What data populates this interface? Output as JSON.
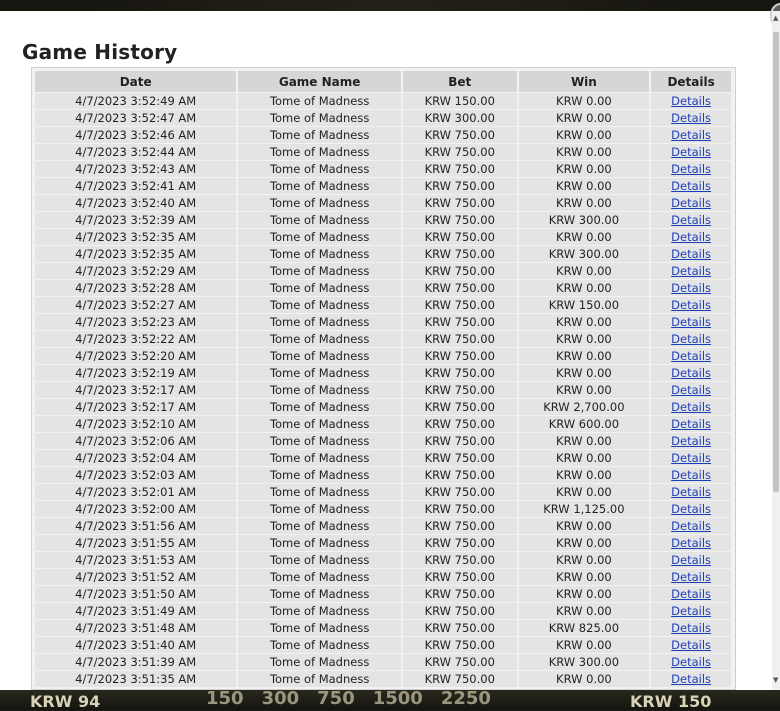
{
  "modal": {
    "title": "Game History",
    "columns": [
      "Date",
      "Game Name",
      "Bet",
      "Win",
      "Details"
    ]
  },
  "rows": [
    {
      "date": "4/7/2023 3:52:49 AM",
      "game": "Tome of Madness",
      "bet": "KRW 150.00",
      "win": "KRW 0.00",
      "details": "Details"
    },
    {
      "date": "4/7/2023 3:52:47 AM",
      "game": "Tome of Madness",
      "bet": "KRW 300.00",
      "win": "KRW 0.00",
      "details": "Details"
    },
    {
      "date": "4/7/2023 3:52:46 AM",
      "game": "Tome of Madness",
      "bet": "KRW 750.00",
      "win": "KRW 0.00",
      "details": "Details"
    },
    {
      "date": "4/7/2023 3:52:44 AM",
      "game": "Tome of Madness",
      "bet": "KRW 750.00",
      "win": "KRW 0.00",
      "details": "Details"
    },
    {
      "date": "4/7/2023 3:52:43 AM",
      "game": "Tome of Madness",
      "bet": "KRW 750.00",
      "win": "KRW 0.00",
      "details": "Details"
    },
    {
      "date": "4/7/2023 3:52:41 AM",
      "game": "Tome of Madness",
      "bet": "KRW 750.00",
      "win": "KRW 0.00",
      "details": "Details"
    },
    {
      "date": "4/7/2023 3:52:40 AM",
      "game": "Tome of Madness",
      "bet": "KRW 750.00",
      "win": "KRW 0.00",
      "details": "Details"
    },
    {
      "date": "4/7/2023 3:52:39 AM",
      "game": "Tome of Madness",
      "bet": "KRW 750.00",
      "win": "KRW 300.00",
      "details": "Details"
    },
    {
      "date": "4/7/2023 3:52:35 AM",
      "game": "Tome of Madness",
      "bet": "KRW 750.00",
      "win": "KRW 0.00",
      "details": "Details"
    },
    {
      "date": "4/7/2023 3:52:35 AM",
      "game": "Tome of Madness",
      "bet": "KRW 750.00",
      "win": "KRW 300.00",
      "details": "Details"
    },
    {
      "date": "4/7/2023 3:52:29 AM",
      "game": "Tome of Madness",
      "bet": "KRW 750.00",
      "win": "KRW 0.00",
      "details": "Details"
    },
    {
      "date": "4/7/2023 3:52:28 AM",
      "game": "Tome of Madness",
      "bet": "KRW 750.00",
      "win": "KRW 0.00",
      "details": "Details"
    },
    {
      "date": "4/7/2023 3:52:27 AM",
      "game": "Tome of Madness",
      "bet": "KRW 750.00",
      "win": "KRW 150.00",
      "details": "Details"
    },
    {
      "date": "4/7/2023 3:52:23 AM",
      "game": "Tome of Madness",
      "bet": "KRW 750.00",
      "win": "KRW 0.00",
      "details": "Details"
    },
    {
      "date": "4/7/2023 3:52:22 AM",
      "game": "Tome of Madness",
      "bet": "KRW 750.00",
      "win": "KRW 0.00",
      "details": "Details"
    },
    {
      "date": "4/7/2023 3:52:20 AM",
      "game": "Tome of Madness",
      "bet": "KRW 750.00",
      "win": "KRW 0.00",
      "details": "Details"
    },
    {
      "date": "4/7/2023 3:52:19 AM",
      "game": "Tome of Madness",
      "bet": "KRW 750.00",
      "win": "KRW 0.00",
      "details": "Details"
    },
    {
      "date": "4/7/2023 3:52:17 AM",
      "game": "Tome of Madness",
      "bet": "KRW 750.00",
      "win": "KRW 0.00",
      "details": "Details"
    },
    {
      "date": "4/7/2023 3:52:17 AM",
      "game": "Tome of Madness",
      "bet": "KRW 750.00",
      "win": "KRW 2,700.00",
      "details": "Details"
    },
    {
      "date": "4/7/2023 3:52:10 AM",
      "game": "Tome of Madness",
      "bet": "KRW 750.00",
      "win": "KRW 600.00",
      "details": "Details"
    },
    {
      "date": "4/7/2023 3:52:06 AM",
      "game": "Tome of Madness",
      "bet": "KRW 750.00",
      "win": "KRW 0.00",
      "details": "Details"
    },
    {
      "date": "4/7/2023 3:52:04 AM",
      "game": "Tome of Madness",
      "bet": "KRW 750.00",
      "win": "KRW 0.00",
      "details": "Details"
    },
    {
      "date": "4/7/2023 3:52:03 AM",
      "game": "Tome of Madness",
      "bet": "KRW 750.00",
      "win": "KRW 0.00",
      "details": "Details"
    },
    {
      "date": "4/7/2023 3:52:01 AM",
      "game": "Tome of Madness",
      "bet": "KRW 750.00",
      "win": "KRW 0.00",
      "details": "Details"
    },
    {
      "date": "4/7/2023 3:52:00 AM",
      "game": "Tome of Madness",
      "bet": "KRW 750.00",
      "win": "KRW 1,125.00",
      "details": "Details"
    },
    {
      "date": "4/7/2023 3:51:56 AM",
      "game": "Tome of Madness",
      "bet": "KRW 750.00",
      "win": "KRW 0.00",
      "details": "Details"
    },
    {
      "date": "4/7/2023 3:51:55 AM",
      "game": "Tome of Madness",
      "bet": "KRW 750.00",
      "win": "KRW 0.00",
      "details": "Details"
    },
    {
      "date": "4/7/2023 3:51:53 AM",
      "game": "Tome of Madness",
      "bet": "KRW 750.00",
      "win": "KRW 0.00",
      "details": "Details"
    },
    {
      "date": "4/7/2023 3:51:52 AM",
      "game": "Tome of Madness",
      "bet": "KRW 750.00",
      "win": "KRW 0.00",
      "details": "Details"
    },
    {
      "date": "4/7/2023 3:51:50 AM",
      "game": "Tome of Madness",
      "bet": "KRW 750.00",
      "win": "KRW 0.00",
      "details": "Details"
    },
    {
      "date": "4/7/2023 3:51:49 AM",
      "game": "Tome of Madness",
      "bet": "KRW 750.00",
      "win": "KRW 0.00",
      "details": "Details"
    },
    {
      "date": "4/7/2023 3:51:48 AM",
      "game": "Tome of Madness",
      "bet": "KRW 750.00",
      "win": "KRW 825.00",
      "details": "Details"
    },
    {
      "date": "4/7/2023 3:51:40 AM",
      "game": "Tome of Madness",
      "bet": "KRW 750.00",
      "win": "KRW 0.00",
      "details": "Details"
    },
    {
      "date": "4/7/2023 3:51:39 AM",
      "game": "Tome of Madness",
      "bet": "KRW 750.00",
      "win": "KRW 300.00",
      "details": "Details"
    },
    {
      "date": "4/7/2023 3:51:35 AM",
      "game": "Tome of Madness",
      "bet": "KRW 750.00",
      "win": "KRW 0.00",
      "details": "Details"
    }
  ],
  "background": {
    "credit_left": "KRW 94",
    "credit_right": "KRW 150",
    "bet_chips": [
      "150",
      "300",
      "750",
      "1500",
      "2250"
    ]
  }
}
